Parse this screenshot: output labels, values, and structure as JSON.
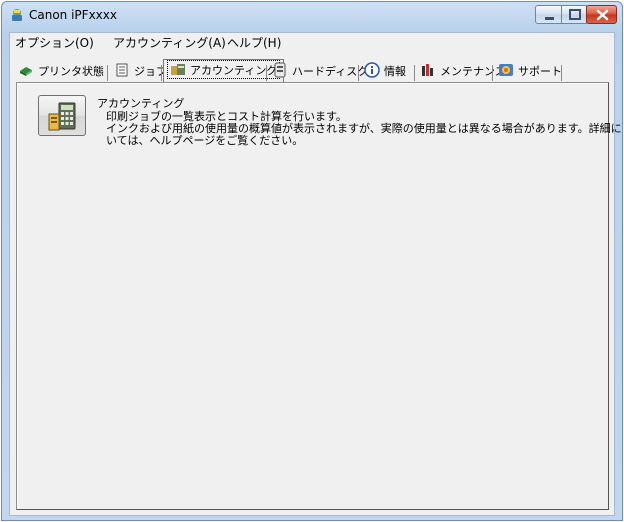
{
  "window": {
    "title": "Canon iPFxxxx"
  },
  "menu": [
    "オプション(O)",
    "アカウンティング(A)",
    "ヘルプ(H)"
  ],
  "tabs": [
    {
      "label": "プリンタ状態",
      "icon": "printer-icon"
    },
    {
      "label": "ジョブ",
      "icon": "job-list-icon"
    },
    {
      "label": "アカウンティング",
      "icon": "accounting-icon",
      "active": true
    },
    {
      "label": "ハードディスク",
      "icon": "hard-disk-icon"
    },
    {
      "label": "情報",
      "icon": "info-icon"
    },
    {
      "label": "メンテナンス",
      "icon": "maintenance-icon"
    },
    {
      "label": "サポート",
      "icon": "support-icon"
    }
  ],
  "accounting": {
    "title": "アカウンティング",
    "lines": [
      "印刷ジョブの一覧表示とコスト計算を行います。",
      "インクおよび用紙の使用量の概算値が表示されますが、実際の使用量とは異なる場合があります。詳細につ",
      "いては、ヘルプページをご覧ください。"
    ]
  }
}
